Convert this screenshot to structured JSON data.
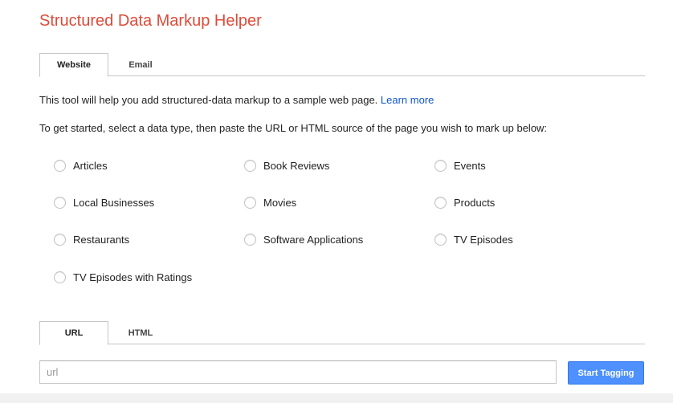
{
  "header": {
    "title": "Structured Data Markup Helper"
  },
  "source_tabs": [
    {
      "label": "Website",
      "active": true
    },
    {
      "label": "Email",
      "active": false
    }
  ],
  "intro": {
    "text": "This tool will help you add structured-data markup to a sample web page. ",
    "link": "Learn more"
  },
  "instructions": "To get started, select a data type, then paste the URL or HTML source of the page you wish to mark up below:",
  "data_types": [
    "Articles",
    "Book Reviews",
    "Events",
    "Local Businesses",
    "Movies",
    "Products",
    "Restaurants",
    "Software Applications",
    "TV Episodes",
    "TV Episodes with Ratings"
  ],
  "input_tabs": [
    {
      "label": "URL",
      "active": true
    },
    {
      "label": "HTML",
      "active": false
    }
  ],
  "url_input": {
    "value": "",
    "placeholder": "url"
  },
  "start_button": {
    "label": "Start Tagging"
  },
  "colors": {
    "title": "#dd4b39",
    "link": "#1155cc",
    "button": "#4d90fe"
  }
}
